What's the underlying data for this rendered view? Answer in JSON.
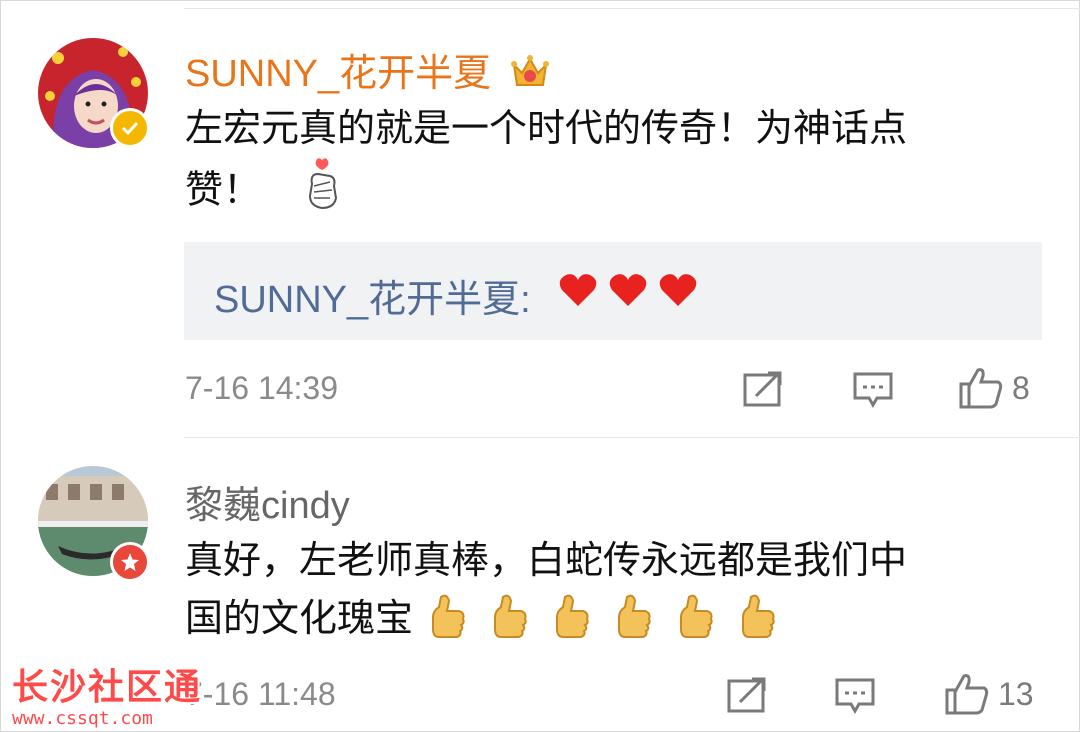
{
  "comments": [
    {
      "username": "SUNNY_花开半夏",
      "username_color": "#e8751a",
      "text_line1": "左宏元真的就是一个时代的传奇！为神话点",
      "text_line2": "赞！",
      "badge": "verified-crown",
      "reply": {
        "username": "SUNNY_花开半夏:",
        "hearts": 3
      },
      "time": "7-16 14:39",
      "likes": "8"
    },
    {
      "username": "黎巍cindy",
      "username_color": "#666666",
      "text_line1": "真好，左老师真棒，白蛇传永远都是我们中",
      "text_line2": "国的文化瑰宝",
      "thumbs": 6,
      "time": "7-16 11:48",
      "likes": "13"
    }
  ],
  "watermark": {
    "title": "长沙社区通",
    "url": "www.cssqt.com"
  },
  "colors": {
    "reply_bg": "#f1f2f4",
    "reply_user": "#506b96",
    "meta": "#8a8a8a"
  }
}
